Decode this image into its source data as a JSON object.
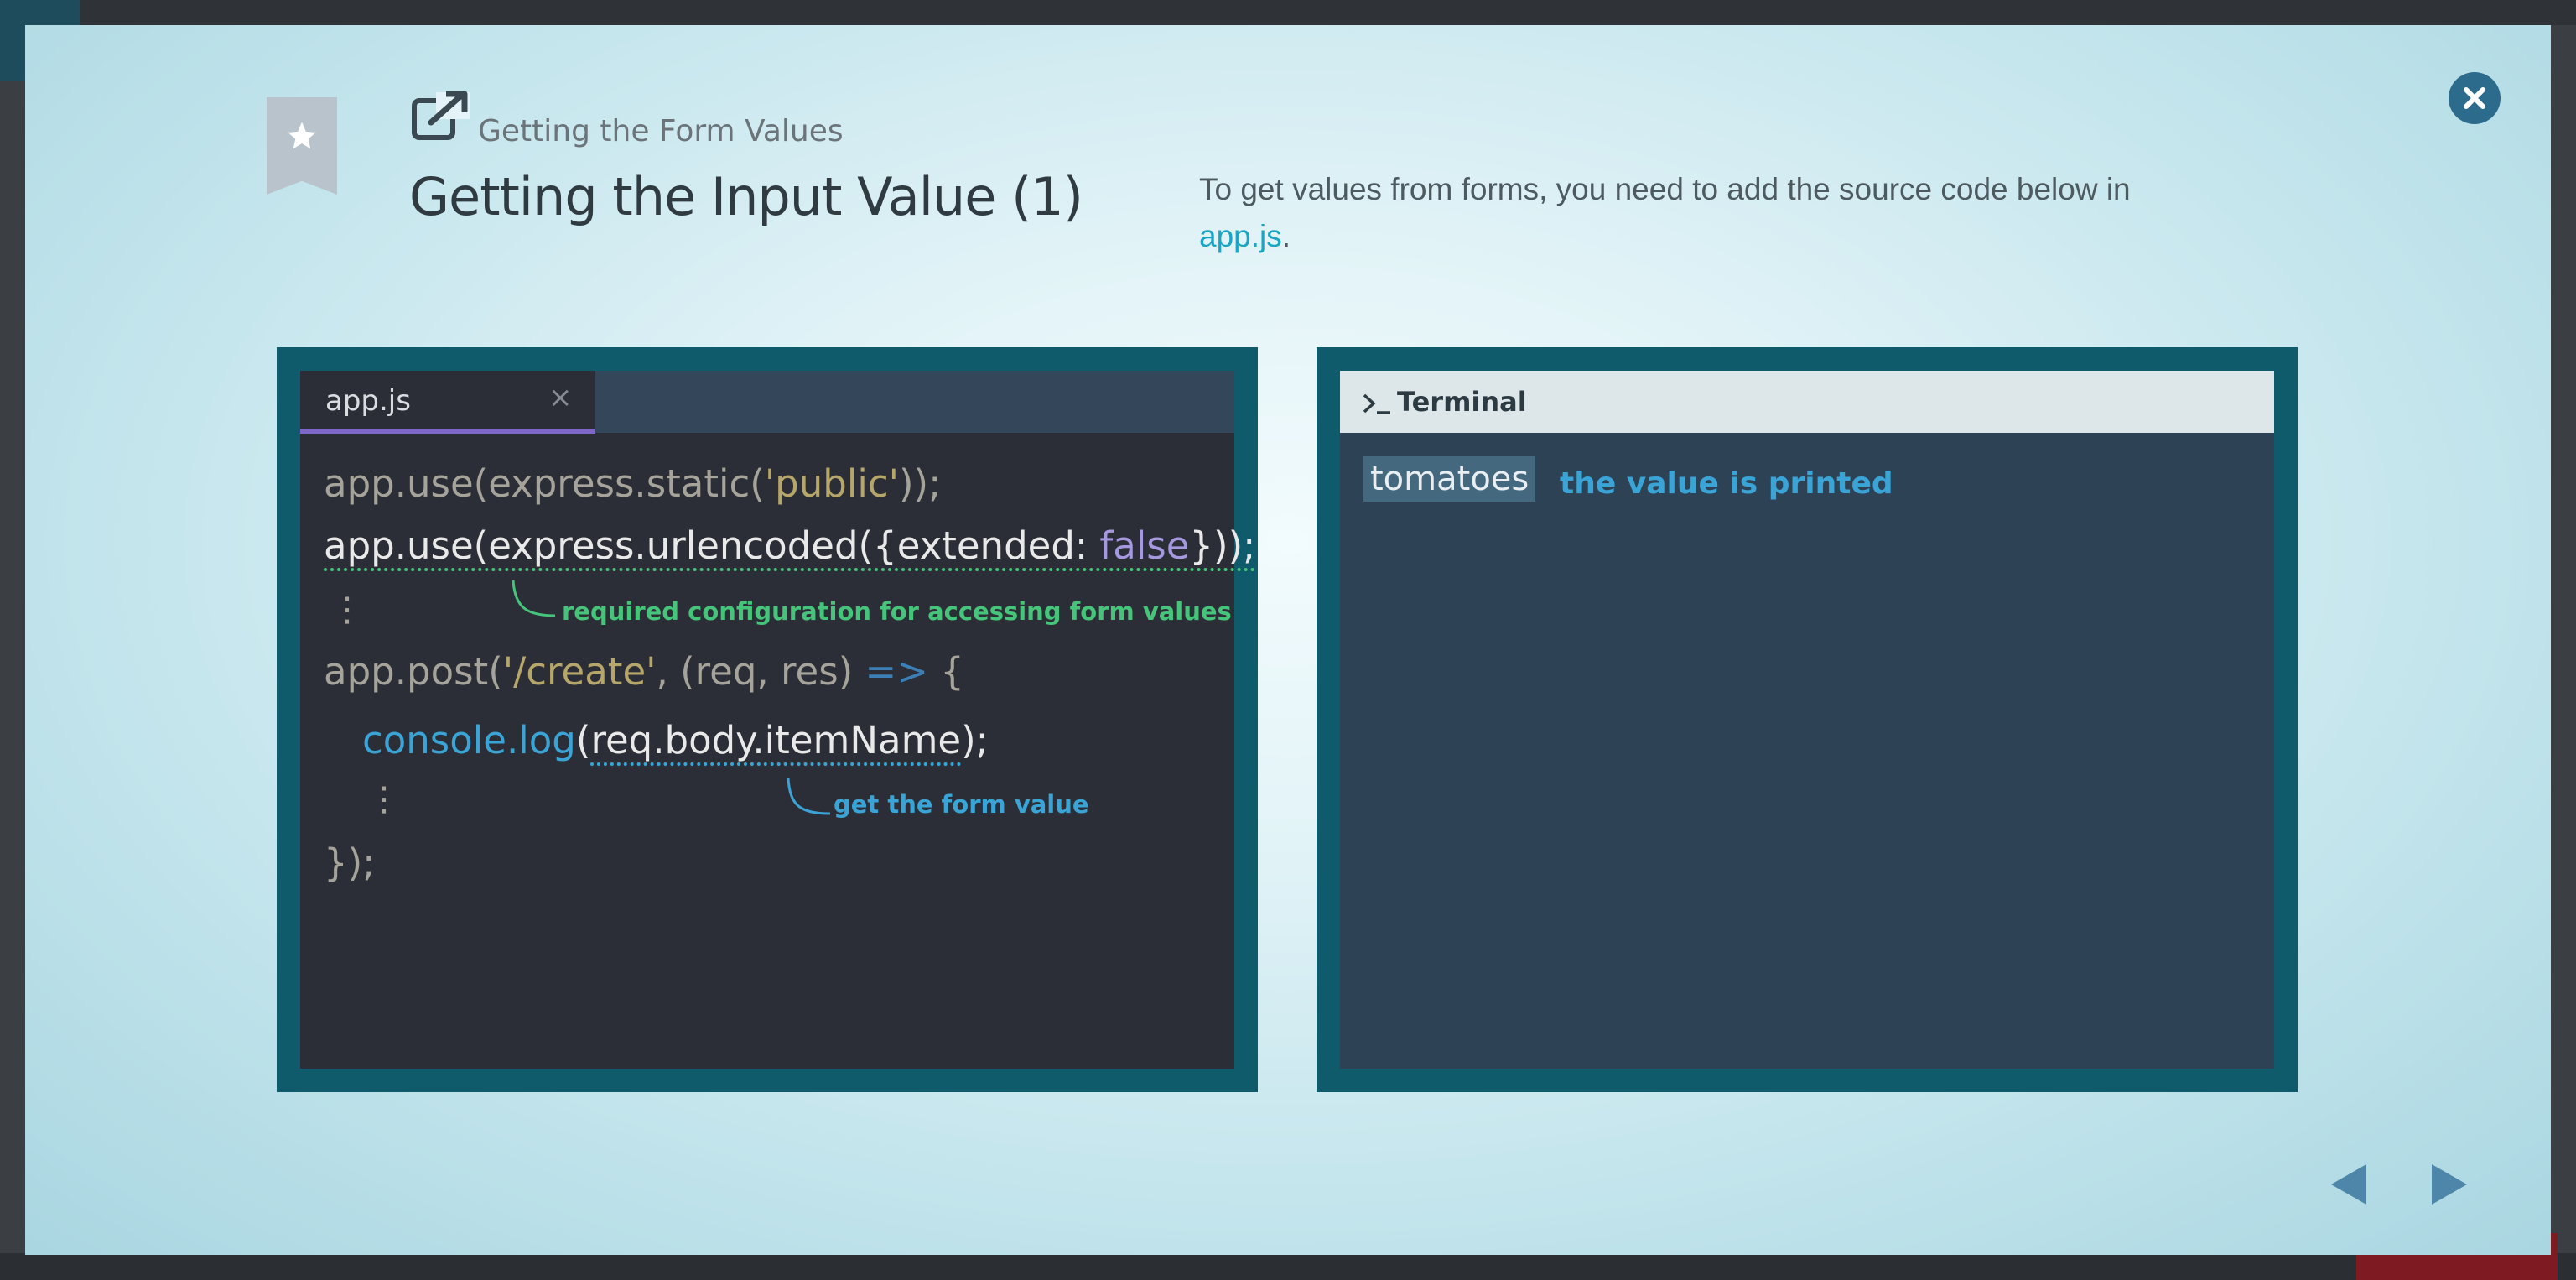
{
  "header": {
    "subtitle": "Getting the Form Values",
    "title": "Getting the Input Value (1)"
  },
  "description": {
    "text": "To get values from forms, you need to add the source code below in",
    "link": "app.js",
    "trailing": "."
  },
  "editor": {
    "tab_name": "app.js",
    "tab_close": "×",
    "lines": {
      "l1_a": "app.use(express.static(",
      "l1_str": "'public'",
      "l1_b": "));",
      "l2_a": "app.use(express.urlencoded({extended: ",
      "l2_kw": "false",
      "l2_b": "}));",
      "dots1": "⋮",
      "l3_a": "app.post(",
      "l3_str": "'/create'",
      "l3_b": ", (req, res) ",
      "l3_op": "=>",
      "l3_c": " {",
      "l4_fn": "console.log",
      "l4_a": "(",
      "l4_arg": "req.body.itemName",
      "l4_b": ");",
      "dots2": "⋮",
      "l5": "});"
    },
    "notes": {
      "config": "required configuration for accessing form values",
      "form_value": "get the form value"
    }
  },
  "terminal": {
    "title": "Terminal",
    "output": "tomatoes",
    "message": "the value is printed"
  },
  "icons": [
    "star-icon",
    "external-link-icon",
    "close-icon",
    "arrow-left-icon",
    "arrow-right-icon",
    "terminal-prompt-icon"
  ],
  "colors": {
    "panel_border": "#0f5b6b",
    "editor_bg": "#2b2e36",
    "terminal_bg": "#2e4256",
    "close_button": "#2d6b8d",
    "accent_link": "#1aa5c6"
  }
}
